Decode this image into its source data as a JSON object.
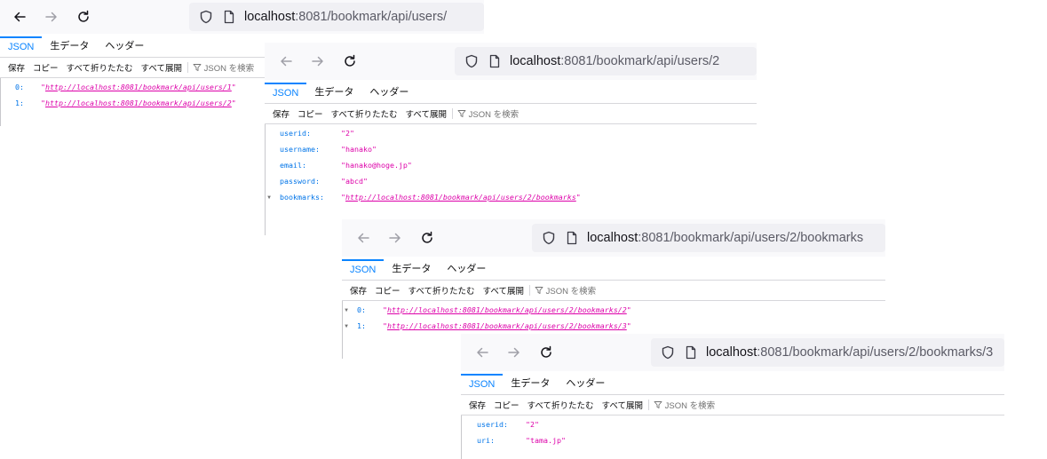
{
  "tabs": {
    "json": "JSON",
    "raw": "生データ",
    "headers": "ヘッダー"
  },
  "actions": {
    "save": "保存",
    "copy": "コピー",
    "collapse_all": "すべて折りたたむ",
    "expand_all": "すべて展開",
    "filter_placeholder": "JSON を検索"
  },
  "windows": [
    {
      "url_host": "localhost",
      "url_rest": ":8081/bookmark/api/users/",
      "rows": [
        {
          "key": "0:",
          "value": "http://localhost:8081/bookmark/api/users/1"
        },
        {
          "key": "1:",
          "value": "http://localhost:8081/bookmark/api/users/2"
        }
      ]
    },
    {
      "url_host": "localhost",
      "url_rest": ":8081/bookmark/api/users/2",
      "rows": [
        {
          "key": "userid:",
          "value": "\"2\""
        },
        {
          "key": "username:",
          "value": "\"hanako\""
        },
        {
          "key": "email:",
          "value": "\"hanako@hoge.jp\""
        },
        {
          "key": "password:",
          "value": "\"abcd\""
        },
        {
          "key": "bookmarks:",
          "value": "http://localhost:8081/bookmark/api/users/2/bookmarks"
        }
      ]
    },
    {
      "url_host": "localhost",
      "url_rest": ":8081/bookmark/api/users/2/bookmarks",
      "rows": [
        {
          "key": "0:",
          "value": "http://localhost:8081/bookmark/api/users/2/bookmarks/2"
        },
        {
          "key": "1:",
          "value": "http://localhost:8081/bookmark/api/users/2/bookmarks/3"
        }
      ]
    },
    {
      "url_host": "localhost",
      "url_rest": ":8081/bookmark/api/users/2/bookmarks/3",
      "rows": [
        {
          "key": "userid:",
          "value": "\"2\""
        },
        {
          "key": "uri:",
          "value": "\"tama.jp\""
        }
      ]
    }
  ]
}
